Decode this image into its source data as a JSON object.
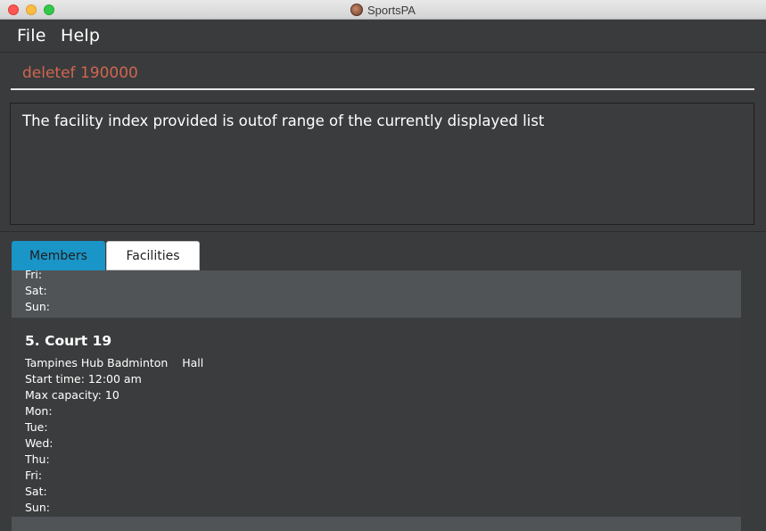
{
  "window": {
    "title": "SportsPA"
  },
  "menu": {
    "file": "File",
    "help": "Help"
  },
  "command": {
    "value": "deletef 190000"
  },
  "result": {
    "message": "The facility index provided is outof range of the currently displayed list"
  },
  "tabs": [
    {
      "label": "Members"
    },
    {
      "label": "Facilities"
    }
  ],
  "facilities": {
    "previous_card": {
      "days": [
        "Fri:",
        "Sat:",
        "Sun:"
      ]
    },
    "card": {
      "title": "5. Court 19",
      "location": "Tampines Hub Badminton    Hall",
      "start_time": "Start time: 12:00 am",
      "max_capacity": "Max capacity: 10",
      "days": [
        "Mon:",
        "Tue:",
        "Wed:",
        "Thu:",
        "Fri:",
        "Sat:",
        "Sun:"
      ]
    }
  },
  "colors": {
    "background": "#3a3b3c",
    "command_text": "#d06651",
    "tab_selected": "#1a95c8",
    "card_alt": "#505457"
  }
}
